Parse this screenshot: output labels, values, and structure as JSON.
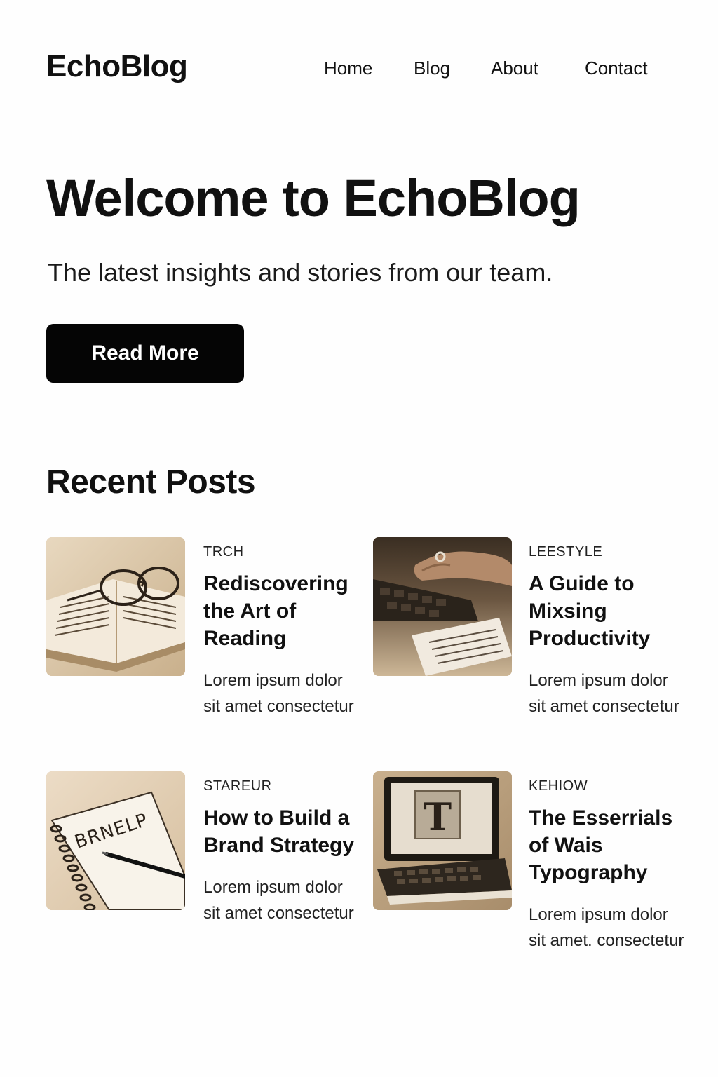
{
  "header": {
    "logo": "EchoBlog",
    "nav": [
      "Home",
      "Blog",
      "About",
      "Contact"
    ]
  },
  "hero": {
    "title": "Welcome to EchoBlog",
    "subtitle": "The latest insights and stories from our team.",
    "cta_label": "Read More"
  },
  "recent": {
    "heading": "Recent Posts",
    "posts": [
      {
        "category": "TRCH",
        "title": "Rediscovering the Art of Reading",
        "excerpt": "Lorem ipsum dolor sit amet consectetur",
        "image": "book-with-glasses"
      },
      {
        "category": "LEESTYLE",
        "title": "A Guide to Mixsing Productivity",
        "excerpt": "Lorem ipsum dolor sit amet consectetur",
        "image": "hand-on-keyboard"
      },
      {
        "category": "STAREUR",
        "title": "How to Build a Brand Strategy",
        "excerpt": "Lorem ipsum dolor sit amet consectetur",
        "image": "notebook-with-pen",
        "image_text": "BRNELP"
      },
      {
        "category": "KEHIOW",
        "title": "The Esserrials of Wais Typography",
        "excerpt": "Lorem ipsum dolor sit amet. consectetur",
        "image": "laptop-with-letter",
        "image_text": "T"
      }
    ]
  },
  "colors": {
    "background": "#fefefe",
    "text": "#111111",
    "button": "#050505",
    "button_text": "#ffffff",
    "photo_tone": "#d9c7ab"
  }
}
